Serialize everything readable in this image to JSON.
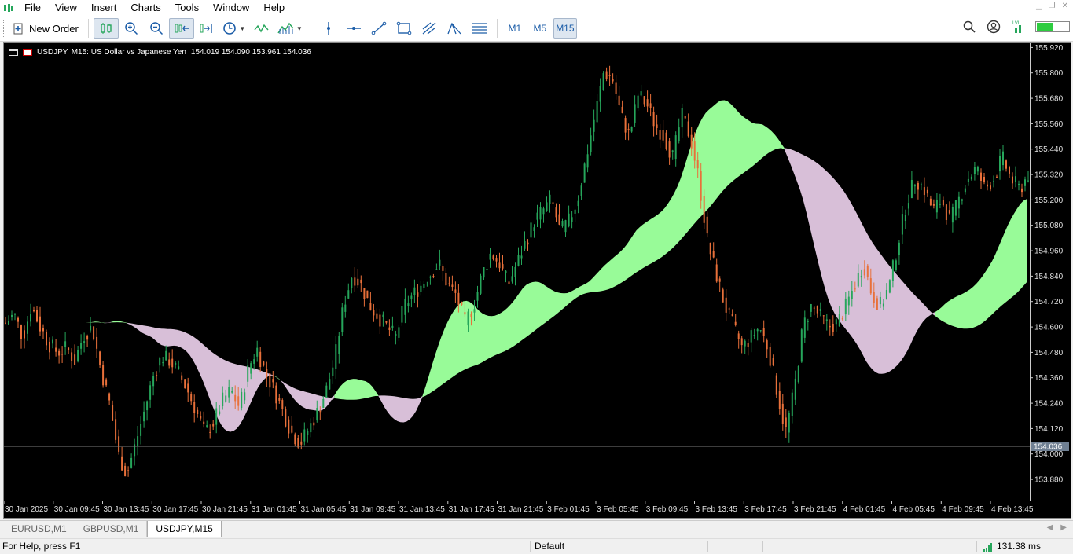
{
  "menu": {
    "items": [
      "File",
      "View",
      "Insert",
      "Charts",
      "Tools",
      "Window",
      "Help"
    ]
  },
  "toolbar": {
    "new_order": "New Order",
    "timeframes": [
      "M1",
      "M5",
      "M15"
    ],
    "active_timeframe": "M15"
  },
  "chart": {
    "title": "USDJPY, M15:  US Dollar vs Japanese Yen",
    "ohlc": "154.019 154.090 153.961 154.036",
    "current_price": "154.036",
    "price_labels": [
      "155.920",
      "155.800",
      "155.680",
      "155.560",
      "155.440",
      "155.320",
      "155.200",
      "155.080",
      "154.960",
      "154.840",
      "154.720",
      "154.600",
      "154.480",
      "154.360",
      "154.240",
      "154.120",
      "154.000",
      "153.880"
    ],
    "time_labels": [
      "30 Jan 2025",
      "30 Jan 09:45",
      "30 Jan 13:45",
      "30 Jan 17:45",
      "30 Jan 21:45",
      "31 Jan 01:45",
      "31 Jan 05:45",
      "31 Jan 09:45",
      "31 Jan 13:45",
      "31 Jan 17:45",
      "31 Jan 21:45",
      "3 Feb 01:45",
      "3 Feb 05:45",
      "3 Feb 09:45",
      "3 Feb 13:45",
      "3 Feb 17:45",
      "3 Feb 21:45",
      "4 Feb 01:45",
      "4 Feb 05:45",
      "4 Feb 09:45",
      "4 Feb 13:45"
    ],
    "colors": {
      "bull": "#26a65b",
      "bear": "#e8703a",
      "cloud_up": "#98fb98",
      "cloud_down": "#d8bfd8"
    }
  },
  "chart_data": {
    "type": "candlestick",
    "price_ylim": [
      153.78,
      155.94
    ],
    "close_path": [
      154.62,
      154.66,
      154.55,
      154.7,
      154.6,
      154.52,
      154.48,
      154.5,
      154.44,
      154.56,
      154.6,
      154.4,
      154.24,
      154.0,
      153.9,
      154.05,
      154.2,
      154.36,
      154.46,
      154.44,
      154.38,
      154.3,
      154.2,
      154.1,
      154.15,
      154.25,
      154.3,
      154.22,
      154.4,
      154.5,
      154.38,
      154.3,
      154.2,
      154.1,
      154.05,
      154.12,
      154.2,
      154.3,
      154.45,
      154.7,
      154.85,
      154.8,
      154.7,
      154.65,
      154.6,
      154.55,
      154.7,
      154.75,
      154.8,
      154.85,
      154.9,
      154.8,
      154.75,
      154.62,
      154.7,
      154.85,
      154.95,
      154.9,
      154.8,
      154.9,
      155.0,
      155.1,
      155.15,
      155.2,
      155.05,
      155.1,
      155.2,
      155.4,
      155.6,
      155.8,
      155.78,
      155.6,
      155.5,
      155.7,
      155.65,
      155.55,
      155.5,
      155.4,
      155.6,
      155.5,
      155.3,
      155.0,
      154.85,
      154.7,
      154.6,
      154.5,
      154.55,
      154.6,
      154.5,
      154.3,
      154.1,
      154.3,
      154.6,
      154.7,
      154.65,
      154.6,
      154.62,
      154.7,
      154.8,
      154.9,
      154.75,
      154.7,
      154.8,
      155.0,
      155.2,
      155.3,
      155.25,
      155.15,
      155.2,
      155.1,
      155.2,
      155.3,
      155.35,
      155.25,
      155.3,
      155.4,
      155.3,
      155.25,
      155.32
    ]
  },
  "tabs": {
    "items": [
      "EURUSD,M1",
      "GBPUSD,M1",
      "USDJPY,M15"
    ],
    "active": "USDJPY,M15"
  },
  "status": {
    "help": "For Help, press F1",
    "profile": "Default",
    "ping": "131.38 ms"
  }
}
